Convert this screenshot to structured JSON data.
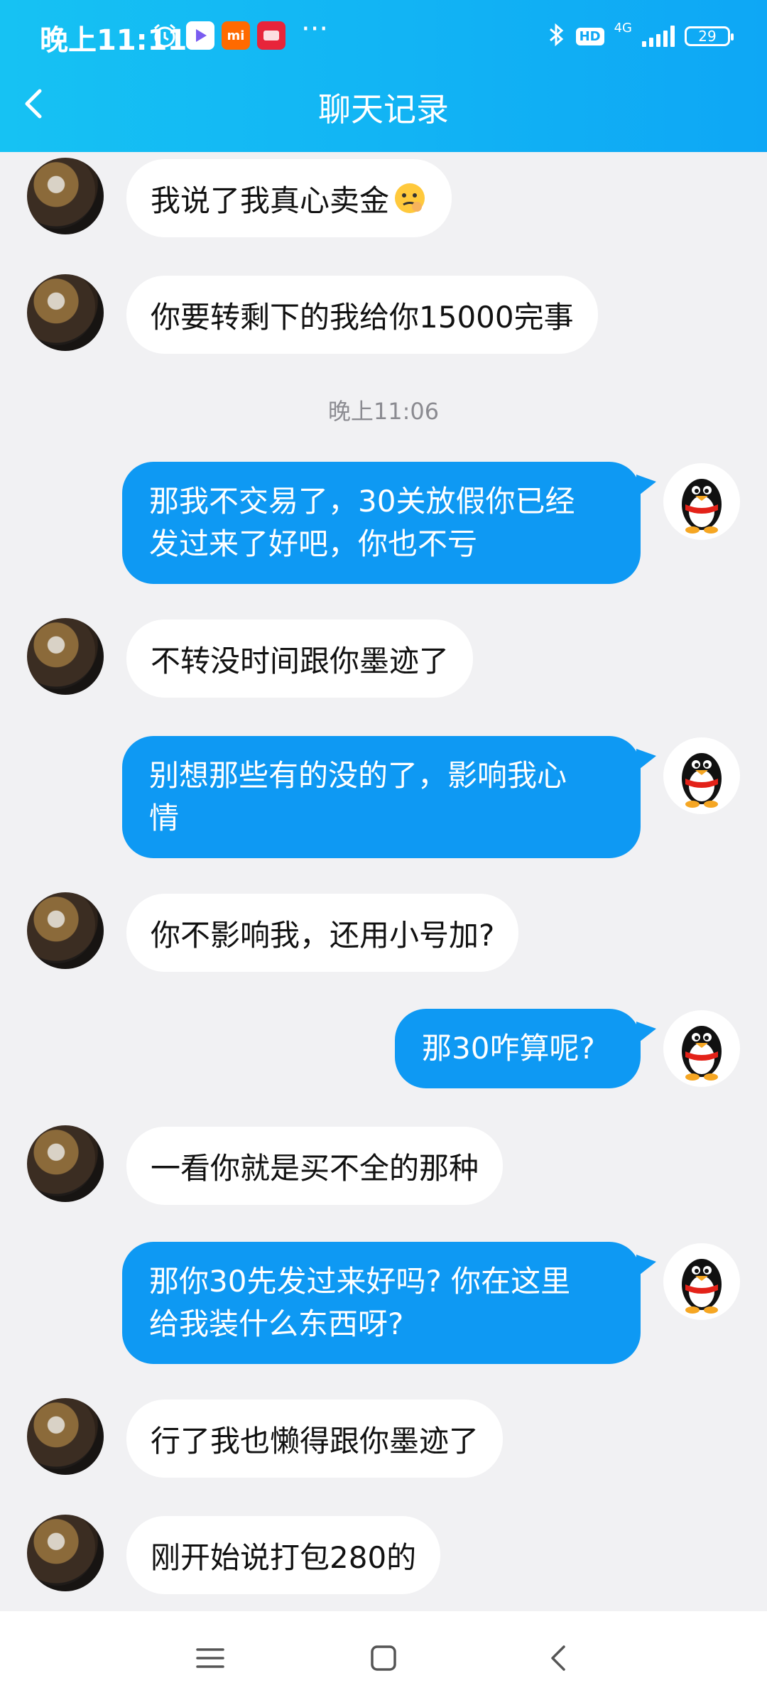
{
  "status_bar": {
    "time": "晚上11:11",
    "apps": [
      "alarm-icon",
      "video-app-icon",
      "mi-app-icon",
      "red-app-icon"
    ],
    "mi_label": "mi",
    "network": "4G",
    "hd": "HD",
    "battery": "29"
  },
  "header": {
    "title": "聊天记录"
  },
  "chat": {
    "timestamp": "晚上11:06",
    "messages": [
      {
        "side": "recv",
        "text": "我说了我真心卖金",
        "emoji": "thinking-face-icon"
      },
      {
        "side": "recv",
        "text": "你要转剩下的我给你15000完事"
      },
      {
        "side": "send",
        "lines": [
          "那我不交易了，30关放假你已经",
          "发过来了好吧，你也不亏"
        ]
      },
      {
        "side": "recv",
        "text": "不转没时间跟你墨迹了"
      },
      {
        "side": "send",
        "lines": [
          "别想那些有的没的了，影响我心",
          "情"
        ]
      },
      {
        "side": "recv",
        "text": "你不影响我，还用小号加?"
      },
      {
        "side": "send",
        "lines": [
          "那30咋算呢?"
        ]
      },
      {
        "side": "recv",
        "text": "一看你就是买不全的那种"
      },
      {
        "side": "send",
        "lines": [
          "那你30先发过来好吗? 你在这里",
          "给我装什么东西呀?"
        ]
      },
      {
        "side": "recv",
        "text": "行了我也懒得跟你墨迹了"
      },
      {
        "side": "recv",
        "text": "刚开始说打包280的"
      }
    ]
  },
  "nav": {
    "items": [
      "menu-icon",
      "home-icon",
      "back-icon"
    ]
  }
}
